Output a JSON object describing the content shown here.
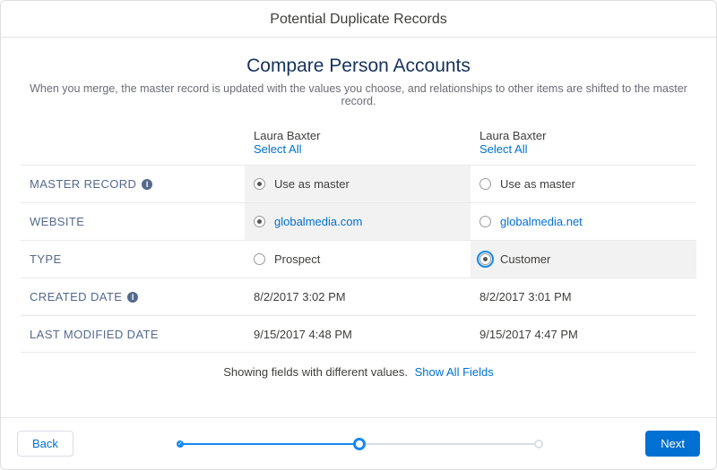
{
  "header": {
    "title": "Potential Duplicate Records"
  },
  "page": {
    "title": "Compare Person Accounts",
    "subtitle": "When you merge, the master record is updated with the values you choose, and relationships to other items are shifted to the master record."
  },
  "columns": [
    {
      "name": "Laura Baxter",
      "select_all": "Select All"
    },
    {
      "name": "Laura Baxter",
      "select_all": "Select All"
    }
  ],
  "rows": {
    "master": {
      "label": "MASTER RECORD",
      "a": "Use as master",
      "b": "Use as master"
    },
    "website": {
      "label": "WEBSITE",
      "a": "globalmedia.com",
      "b": "globalmedia.net"
    },
    "type": {
      "label": "TYPE",
      "a": "Prospect",
      "b": "Customer"
    },
    "created": {
      "label": "CREATED DATE",
      "a": "8/2/2017 3:02 PM",
      "b": "8/2/2017 3:01 PM"
    },
    "modified": {
      "label": "LAST MODIFIED DATE",
      "a": "9/15/2017 4:48 PM",
      "b": "9/15/2017 4:47 PM"
    }
  },
  "footer_note": {
    "text": "Showing fields with different values.",
    "link": "Show All Fields"
  },
  "buttons": {
    "back": "Back",
    "next": "Next"
  }
}
